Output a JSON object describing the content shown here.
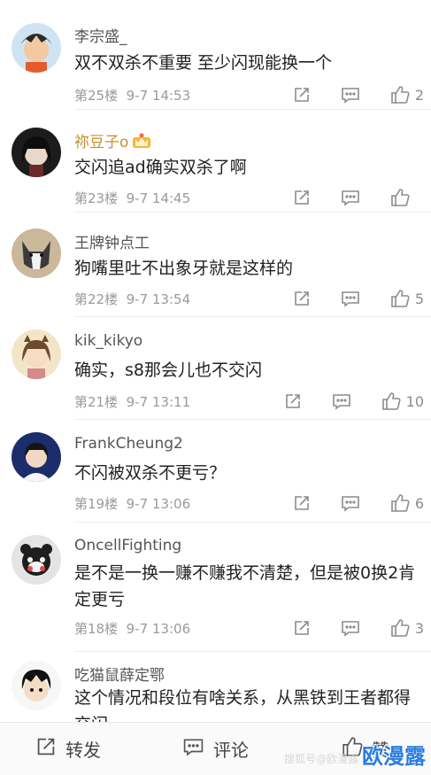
{
  "comments": [
    {
      "user": "李宗盛_",
      "text": "双不双杀不重要  至少闪现能换一个",
      "floor": "第25楼",
      "time": "9-7 14:53",
      "likes": "2"
    },
    {
      "user": "祢豆子o",
      "text": "交闪追ad确实双杀了啊",
      "floor": "第23楼",
      "time": "9-7 14:45",
      "likes": ""
    },
    {
      "user": "王牌钟点工",
      "text": "狗嘴里吐不出象牙就是这样的",
      "floor": "第22楼",
      "time": "9-7 13:54",
      "likes": "5"
    },
    {
      "user": "kik_kikyo",
      "text": "确实，s8那会儿也不交闪",
      "floor": "第21楼",
      "time": "9-7 13:11",
      "likes": "10"
    },
    {
      "user": "FrankCheung2",
      "text": "不闪被双杀不更亏？",
      "floor": "第19楼",
      "time": "9-7 13:06",
      "likes": "6"
    },
    {
      "user": "OncellFighting",
      "text": "是不是一换一赚不赚我不清楚，但是被0换2肯定更亏",
      "floor": "第18楼",
      "time": "9-7 13:06",
      "likes": "3"
    },
    {
      "user": "吃猫鼠薛定鄂",
      "text": "这个情况和段位有啥关系，从黑铁到王者都得交闪",
      "floor": "",
      "time": "",
      "likes": ""
    }
  ],
  "bottom_bar": {
    "repost_label": "转发",
    "comment_label": "评论",
    "like_label": "赞"
  },
  "watermark": {
    "small": "搜狐号@欧漫露",
    "big": "欧漫露"
  },
  "colors": {
    "vip_name": "#c8902a",
    "watermark": "#2b7de0"
  },
  "icons": {
    "share": "share-icon",
    "reply": "comment-icon",
    "like": "thumbs-up-icon",
    "crown": "vip-crown-icon"
  }
}
